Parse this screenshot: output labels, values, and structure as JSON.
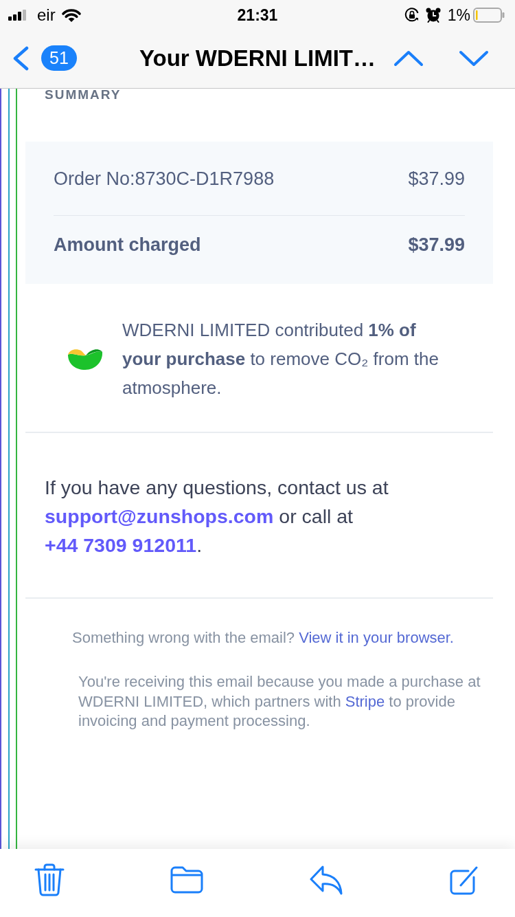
{
  "status_bar": {
    "carrier": "eir",
    "time": "21:31",
    "battery_percent": "1%"
  },
  "nav_bar": {
    "unread_count": "51",
    "title": "Your WDERNI LIMIT…"
  },
  "email": {
    "section_heading": "SUMMARY",
    "summary_rows": [
      {
        "kind": "item",
        "label": "Order No:8730C-D1R7988",
        "amount": "$37.99"
      },
      {
        "kind": "total",
        "label": "Amount charged",
        "amount": "$37.99"
      }
    ],
    "contribution": "WDERNI LIMITED contributed **1% of your purchase** to remove CO₂ from the atmosphere.",
    "contact": [
      {
        "kind": "text",
        "text": "If you have any questions, contact us at "
      },
      {
        "kind": "link",
        "text": "support@zunshops.com"
      },
      {
        "kind": "text",
        "text": " or call at "
      },
      {
        "kind": "link",
        "text": "+44 7309 912011"
      },
      {
        "kind": "text",
        "text": "."
      }
    ],
    "footer_notice": [
      {
        "kind": "text",
        "text": "Something wrong with the email? "
      },
      {
        "kind": "link",
        "text": "View it in your browser."
      }
    ],
    "footer_legal": [
      {
        "kind": "text",
        "text": "You're receiving this email because you made a purchase at WDERNI LIMITED, which partners with "
      },
      {
        "kind": "link",
        "text": "Stripe"
      },
      {
        "kind": "text",
        "text": " to provide invoicing and payment processing."
      }
    ]
  }
}
